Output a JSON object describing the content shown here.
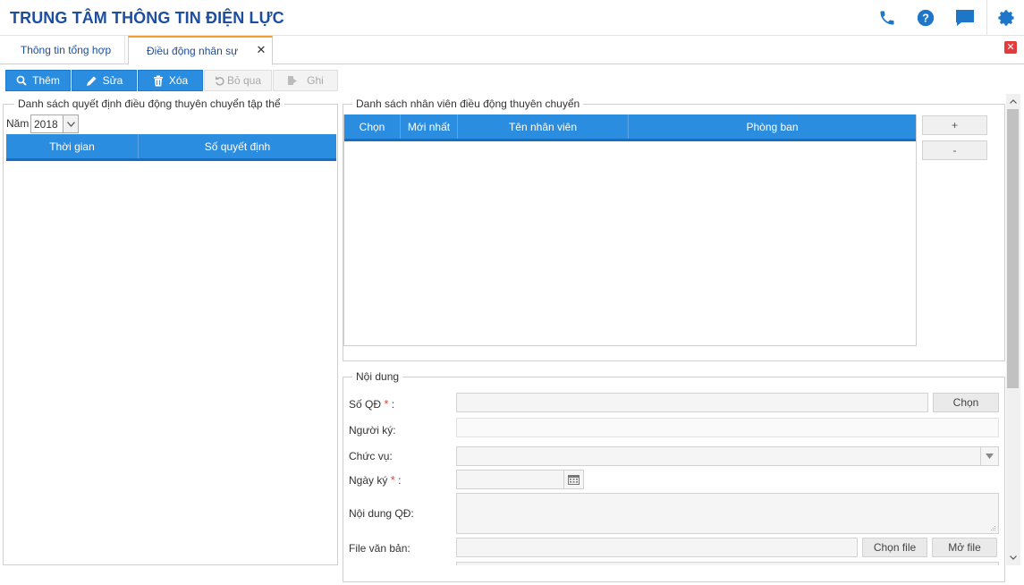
{
  "header": {
    "title": "TRUNG TÂM THÔNG TIN ĐIỆN LỰC",
    "icons": [
      "phone-icon",
      "help-icon",
      "chat-icon",
      "gear-icon"
    ],
    "accent": "#1c4fa0"
  },
  "tabs": [
    {
      "label": "Thông tin tổng hợp",
      "active": false
    },
    {
      "label": "Điều động nhân sự",
      "active": true
    }
  ],
  "toolbar": {
    "add_label": "Thêm",
    "edit_label": "Sửa",
    "delete_label": "Xóa",
    "skip_label": "Bỏ qua",
    "save_label": "Ghi"
  },
  "left_panel": {
    "legend": "Danh sách quyết định điều động thuyên chuyển tập thể",
    "year_label": "Năm",
    "year_value": "2018",
    "columns": [
      "Thời gian",
      "Số quyết định"
    ]
  },
  "right_panel": {
    "legend": "Danh sách nhân viên điều động thuyên chuyển",
    "columns": [
      "Chọn",
      "Mới nhất",
      "Tên nhân viên",
      "Phòng ban"
    ],
    "add_row": "+",
    "remove_row": "-"
  },
  "content": {
    "legend": "Nội dung",
    "so_qd_label": "Số QĐ",
    "required_mark": "*",
    "colon": ":",
    "choose_label": "Chọn",
    "nguoi_ky_label": "Người ký:",
    "chuc_vu_label": "Chức vụ:",
    "ngay_ky_label": "Ngày ký",
    "noi_dung_label": "Nội dung QĐ:",
    "file_label": "File văn bản:",
    "choose_file_label": "Chọn file",
    "open_file_label": "Mở file"
  },
  "colors": {
    "primary": "#2b8de0",
    "required": "#e23b3b",
    "tab_accent": "#f0a030"
  }
}
